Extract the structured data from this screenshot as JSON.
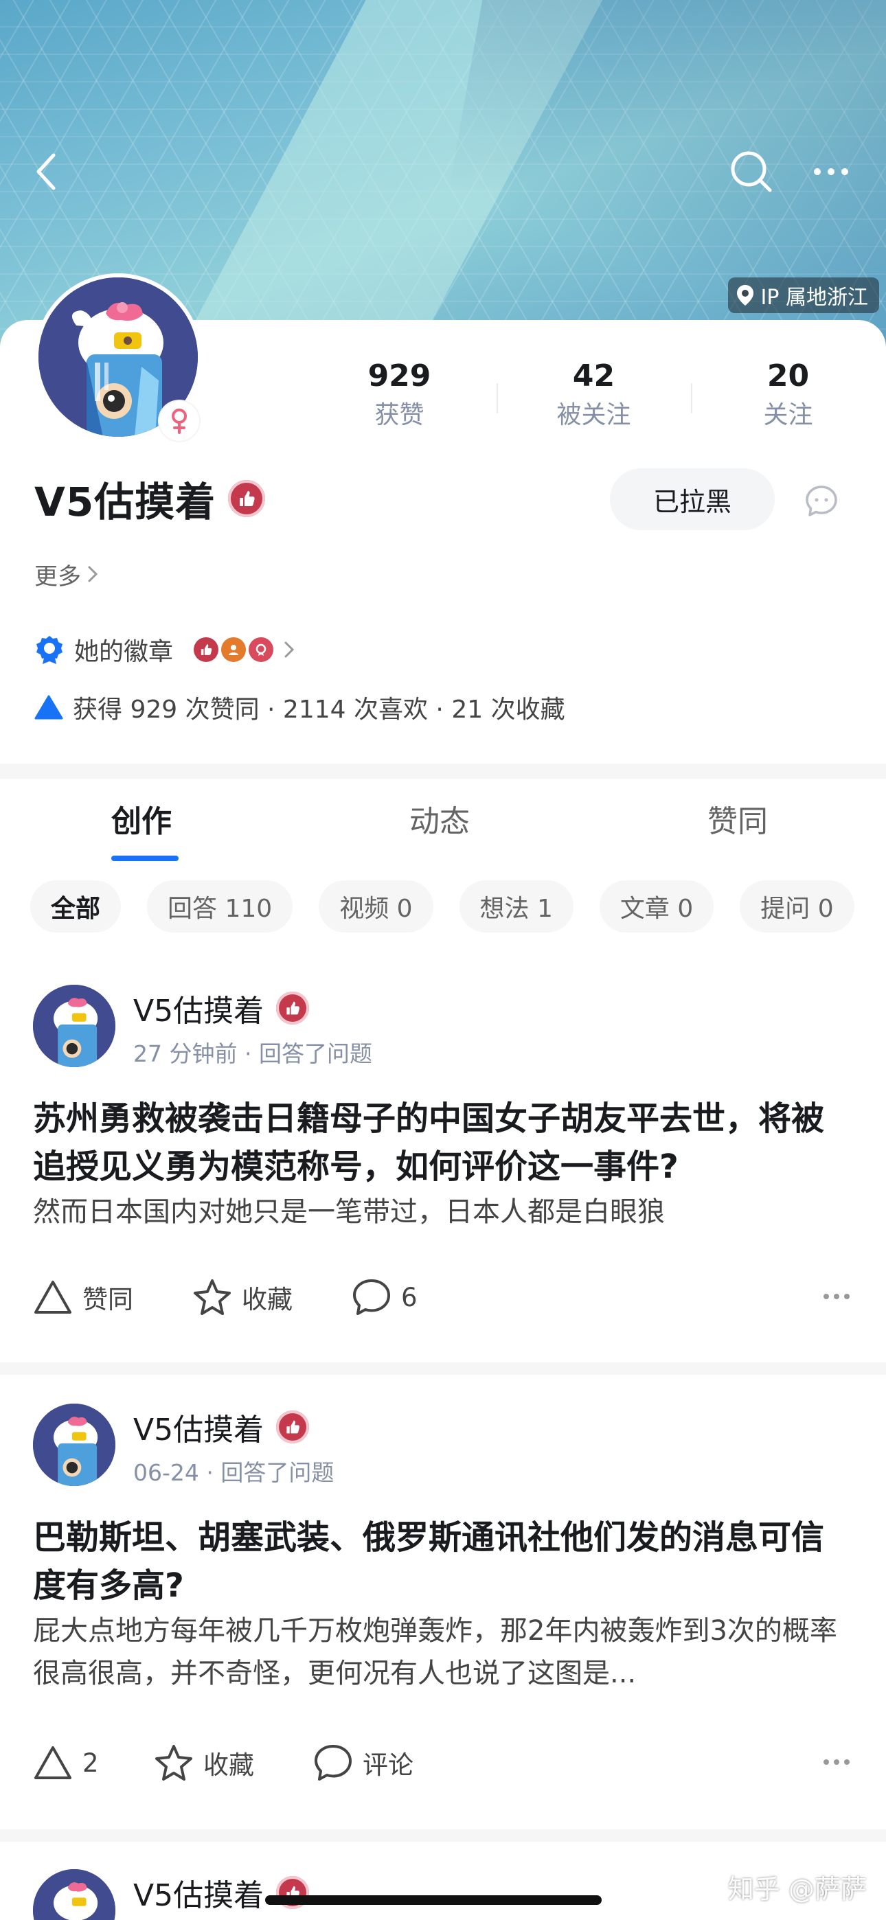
{
  "header": {
    "ip_location": "IP 属地浙江"
  },
  "profile": {
    "name": "V5估摸着",
    "stats": [
      {
        "value": "929",
        "label": "获赞"
      },
      {
        "value": "42",
        "label": "被关注"
      },
      {
        "value": "20",
        "label": "关注"
      }
    ],
    "blocked_button": "已拉黑",
    "more_link": "更多",
    "badges_label": "她的徽章",
    "achievements": "获得 929 次赞同 · 2114 次喜欢 · 21 次收藏"
  },
  "tabs": [
    {
      "label": "创作",
      "active": true
    },
    {
      "label": "动态",
      "active": false
    },
    {
      "label": "赞同",
      "active": false
    }
  ],
  "filters": [
    {
      "label": "全部",
      "active": true
    },
    {
      "label": "回答 110"
    },
    {
      "label": "视频 0"
    },
    {
      "label": "想法 1"
    },
    {
      "label": "文章 0"
    },
    {
      "label": "提问 0"
    }
  ],
  "posts": [
    {
      "author": "V5估摸着",
      "meta": "27 分钟前 · 回答了问题",
      "title": "苏州勇救被袭击日籍母子的中国女子胡友平去世，将被追授见义勇为模范称号，如何评价这一事件?",
      "excerpt": "然而日本国内对她只是一笔带过，日本人都是白眼狼",
      "actions": {
        "upvote": "赞同",
        "collect": "收藏",
        "comment": "6"
      }
    },
    {
      "author": "V5估摸着",
      "meta": "06-24 · 回答了问题",
      "title": "巴勒斯坦、胡塞武装、俄罗斯通讯社他们发的消息可信度有多高?",
      "excerpt": "屁大点地方每年被几千万枚炮弹轰炸，那2年内被轰炸到3次的概率很高很高，并不奇怪，更何况有人也说了这图是...",
      "actions": {
        "upvote": "2",
        "collect": "收藏",
        "comment": "评论"
      }
    },
    {
      "author": "V5估摸着"
    }
  ],
  "watermark": "知乎 @萨萨",
  "colors": {
    "accent": "#1772f6",
    "badge_red": "#c43a4c",
    "text_primary": "#191b1f",
    "text_secondary": "#8590a6"
  }
}
